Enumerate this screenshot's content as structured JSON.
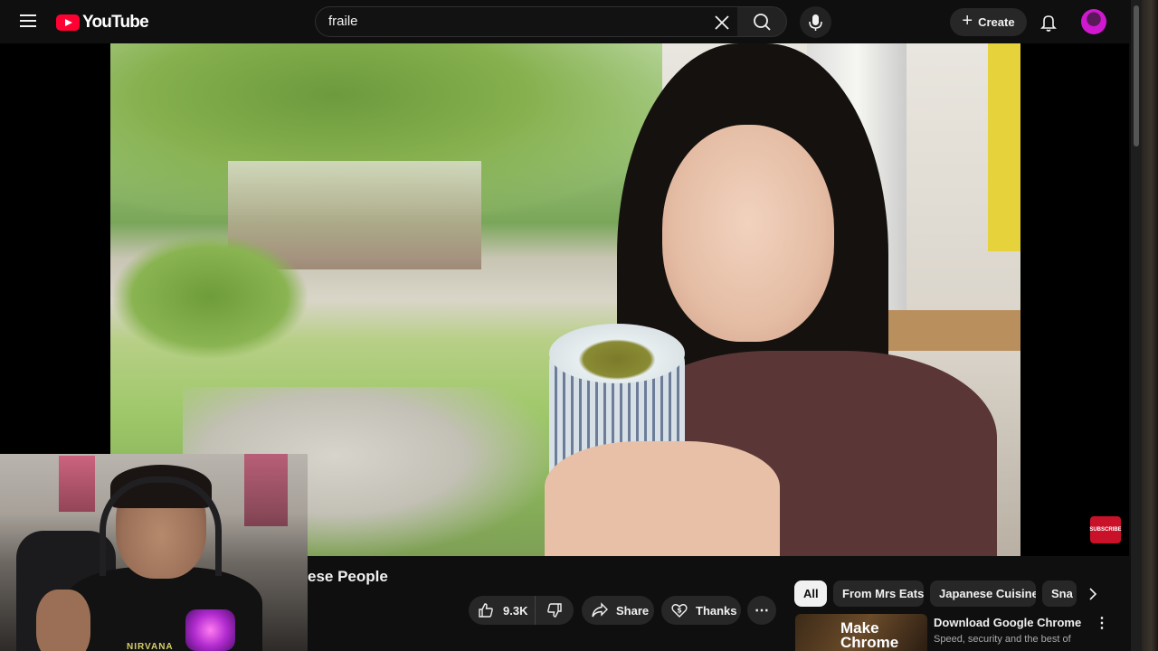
{
  "header": {
    "logo_text": "YouTube",
    "search_value": "fraile",
    "create_label": "Create"
  },
  "video": {
    "title_visible": "ese People",
    "subscribe_overlay": "SUBSCRIBE",
    "like_count": "9.3K",
    "share_label": "Share",
    "thanks_label": "Thanks"
  },
  "chips": [
    {
      "label": "All",
      "active": true
    },
    {
      "label": "From Mrs Eats",
      "active": false
    },
    {
      "label": "Japanese Cuisine",
      "active": false
    },
    {
      "label": "Sna",
      "active": false
    }
  ],
  "ad": {
    "thumb_text": "Make Chrome",
    "title": "Download Google Chrome",
    "description": "Speed, security and the best of"
  },
  "webcam": {
    "shirt_text": "NIRVANA"
  },
  "colors": {
    "background": "#0f0f0f",
    "brand_red": "#ff0033",
    "chip_bg": "#272727"
  }
}
